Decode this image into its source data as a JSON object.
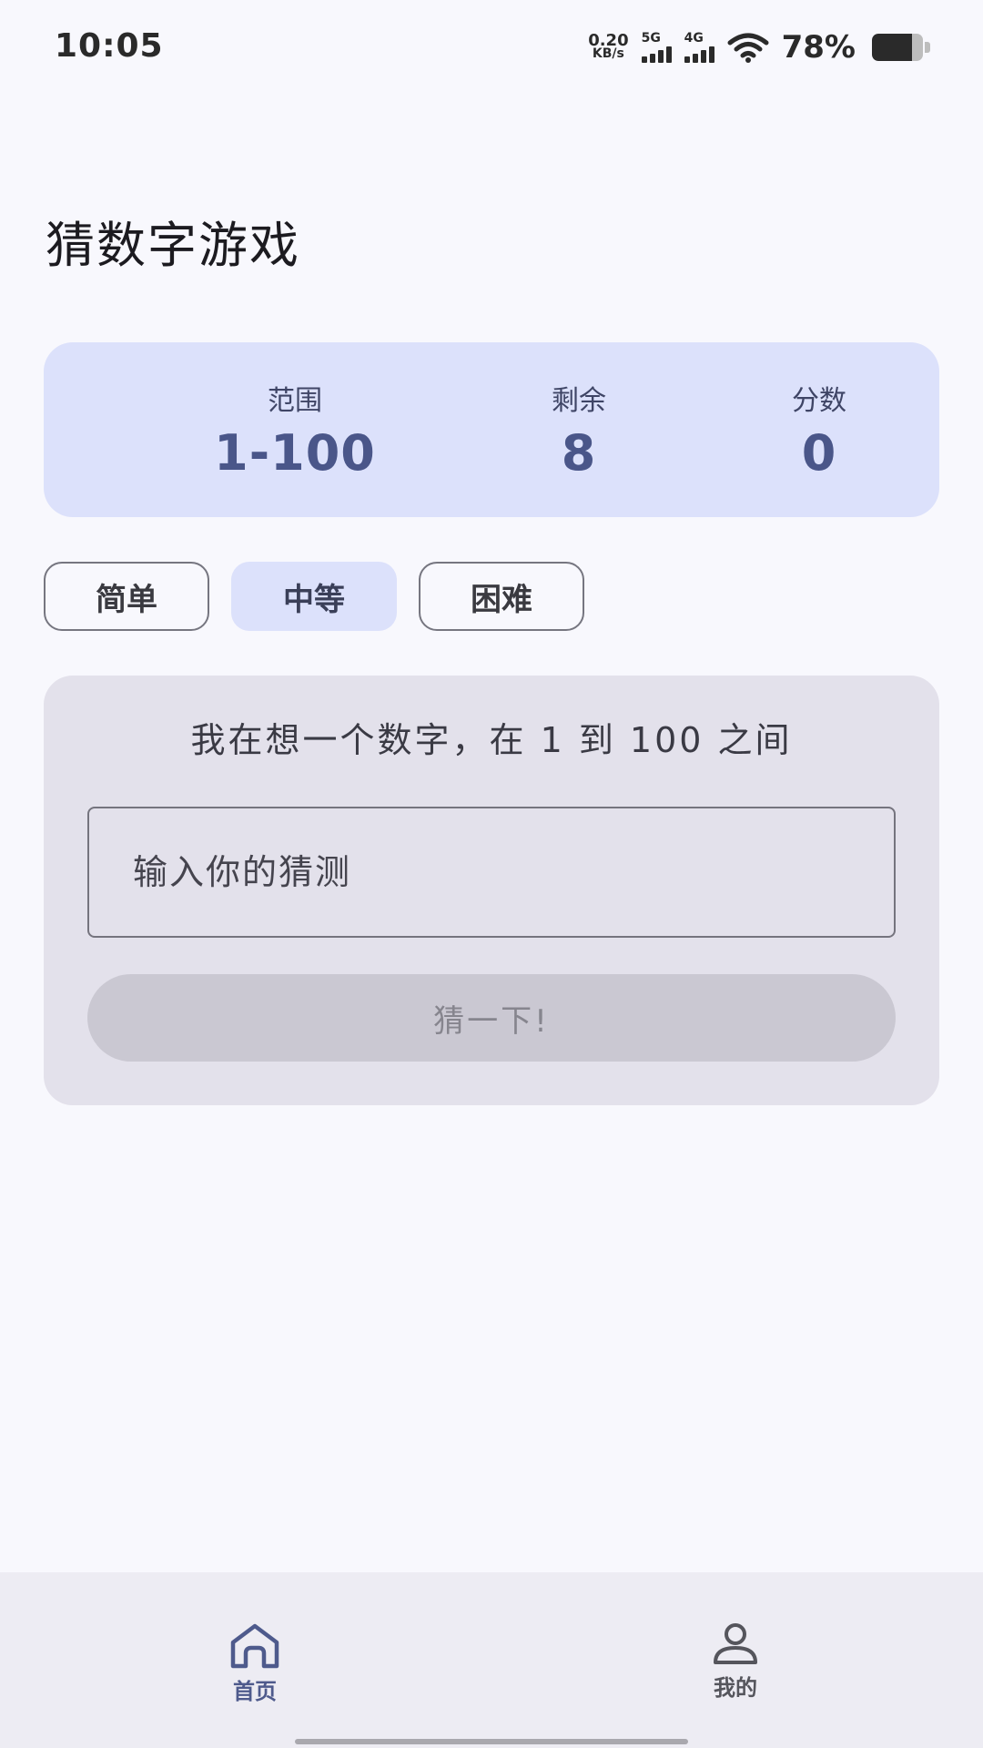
{
  "status_bar": {
    "time": "10:05",
    "net_speed_value": "0.20",
    "net_speed_unit": "KB/s",
    "signal_1_label": "5G",
    "signal_2_label": "4G",
    "battery_percent": "78%",
    "battery_level": 0.78
  },
  "page": {
    "title": "猜数字游戏"
  },
  "stats": {
    "range_label": "范围",
    "range_value": "1-100",
    "remaining_label": "剩余",
    "remaining_value": "8",
    "score_label": "分数",
    "score_value": "0"
  },
  "difficulty": {
    "options": [
      "简单",
      "中等",
      "困难"
    ],
    "selected": "中等"
  },
  "game": {
    "hint": "我在想一个数字，在 1 到 100 之间",
    "input_placeholder": "输入你的猜测",
    "input_value": "",
    "guess_button": "猜一下!"
  },
  "nav": {
    "home_label": "首页",
    "profile_label": "我的",
    "active": "首页"
  },
  "colors": {
    "background": "#f8f8fd",
    "stats_card": "#dce1fb",
    "accent": "#4a5689",
    "game_card": "#e3e1eb",
    "button_disabled": "#cac8d2",
    "nav_background": "#edecf3"
  },
  "icons": {
    "home": "home-icon",
    "profile": "person-icon",
    "wifi": "wifi-icon",
    "battery": "battery-icon"
  }
}
